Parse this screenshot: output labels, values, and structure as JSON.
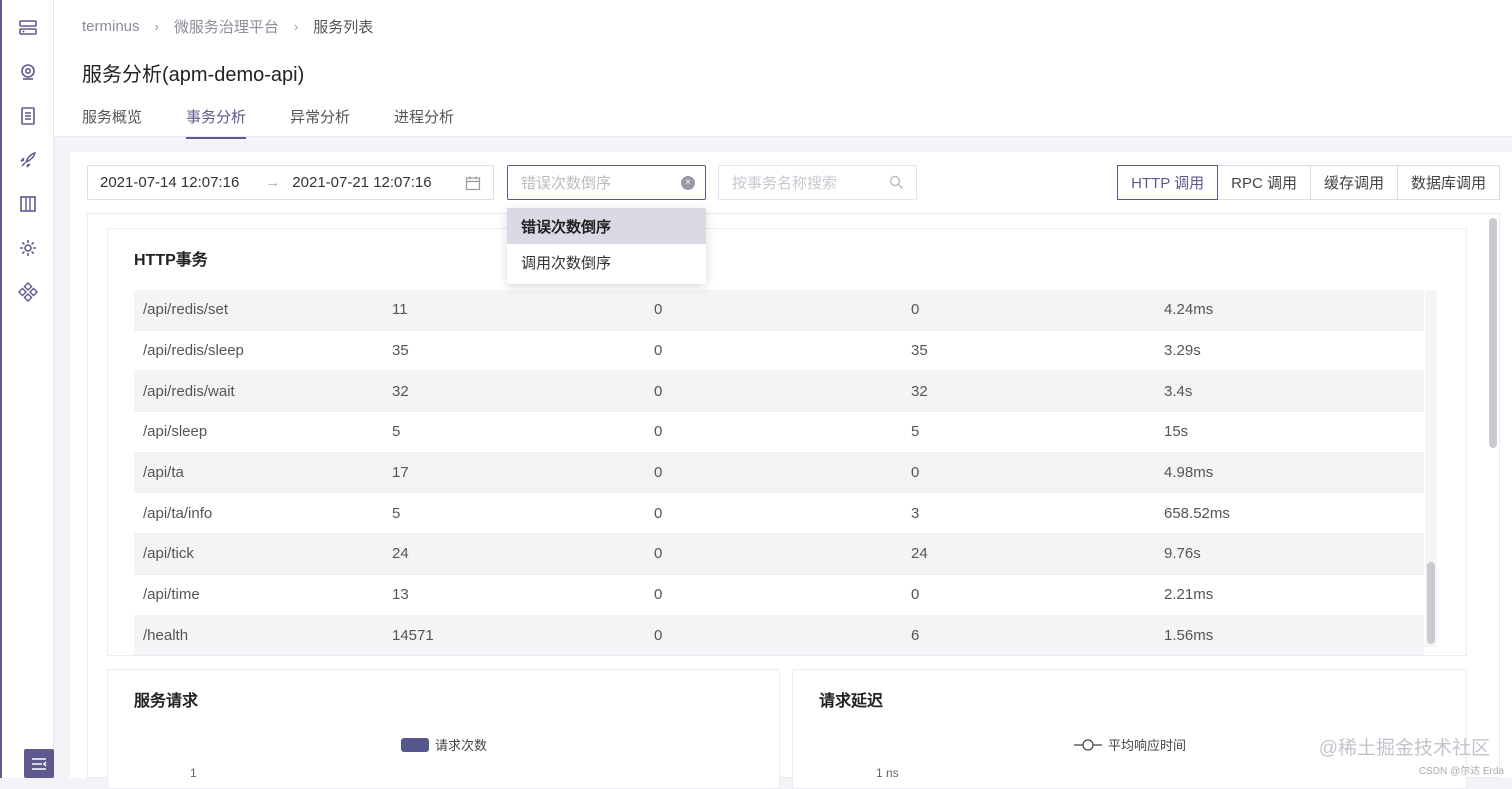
{
  "rail": {
    "icons": [
      "server-icon",
      "webcam-icon",
      "document-icon",
      "rocket-icon",
      "book-icon",
      "gear-icon",
      "apps-icon"
    ]
  },
  "breadcrumb": {
    "items": [
      "terminus",
      "微服务治理平台",
      "服务列表"
    ]
  },
  "page_title": "服务分析(apm-demo-api)",
  "tabs": [
    {
      "label": "服务概览",
      "active": false
    },
    {
      "label": "事务分析",
      "active": true
    },
    {
      "label": "异常分析",
      "active": false
    },
    {
      "label": "进程分析",
      "active": false
    }
  ],
  "toolbar": {
    "date_start": "2021-07-14 12:07:16",
    "date_end": "2021-07-21 12:07:16",
    "sort_placeholder": "错误次数倒序",
    "search_placeholder": "按事务名称搜索",
    "call_types": [
      {
        "label": "HTTP 调用",
        "active": true
      },
      {
        "label": "RPC 调用",
        "active": false
      },
      {
        "label": "缓存调用",
        "active": false
      },
      {
        "label": "数据库调用",
        "active": false
      }
    ]
  },
  "dropdown": {
    "options": [
      {
        "label": "错误次数倒序",
        "selected": true
      },
      {
        "label": "调用次数倒序",
        "selected": false
      }
    ]
  },
  "http_panel": {
    "title": "HTTP事务",
    "rows": [
      [
        "/api/redis/set",
        "11",
        "0",
        "0",
        "4.24ms"
      ],
      [
        "/api/redis/sleep",
        "35",
        "0",
        "35",
        "3.29s"
      ],
      [
        "/api/redis/wait",
        "32",
        "0",
        "32",
        "3.4s"
      ],
      [
        "/api/sleep",
        "5",
        "0",
        "5",
        "15s"
      ],
      [
        "/api/ta",
        "17",
        "0",
        "0",
        "4.98ms"
      ],
      [
        "/api/ta/info",
        "5",
        "0",
        "3",
        "658.52ms"
      ],
      [
        "/api/tick",
        "24",
        "0",
        "24",
        "9.76s"
      ],
      [
        "/api/time",
        "13",
        "0",
        "0",
        "2.21ms"
      ],
      [
        "/health",
        "14571",
        "0",
        "6",
        "1.56ms"
      ]
    ]
  },
  "service_request": {
    "title": "服务请求",
    "legend": "请求次数",
    "ytick": "1",
    "color": "#56578c"
  },
  "request_latency": {
    "title": "请求延迟",
    "legend": "平均响应时间",
    "ytick": "1 ns"
  },
  "watermark": "@稀土掘金技术社区",
  "watermark_small": "CSDN @尔达 Erda"
}
